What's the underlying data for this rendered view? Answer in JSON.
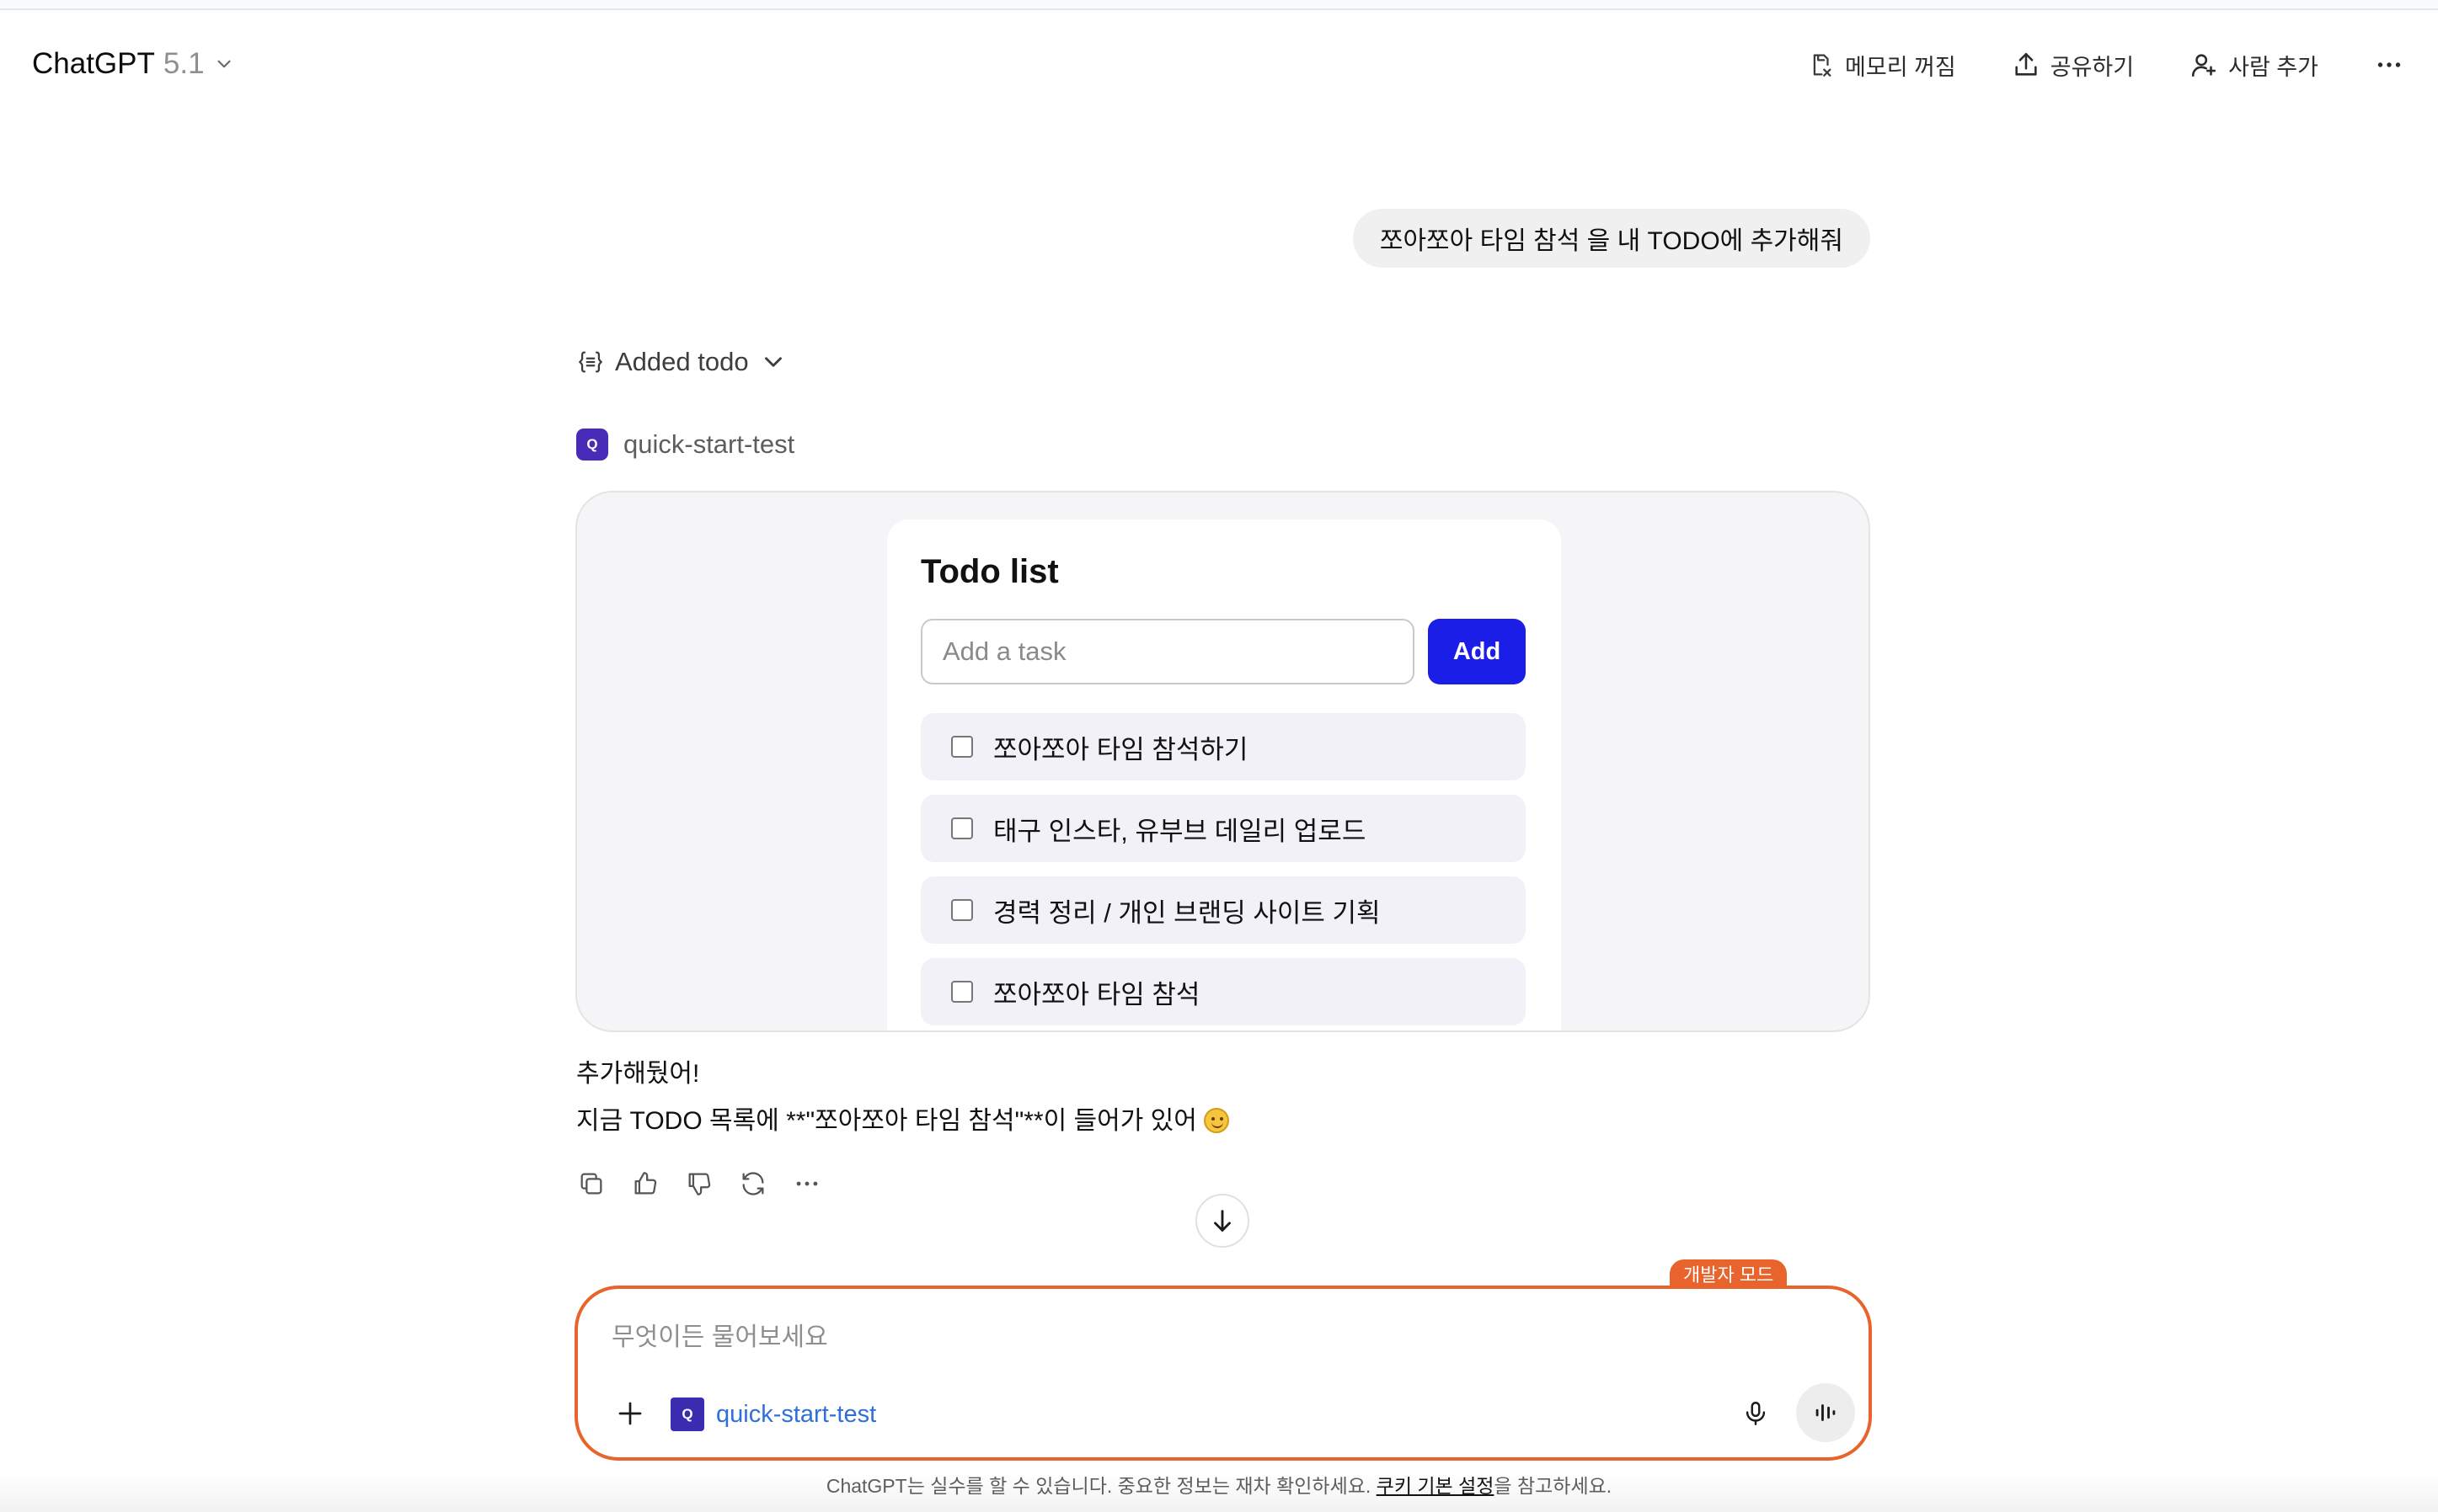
{
  "header": {
    "model_name": "ChatGPT",
    "model_version": "5.1",
    "memory_label": "메모리 꺼짐",
    "share_label": "공유하기",
    "add_people_label": "사람 추가"
  },
  "conversation": {
    "user_message": "쪼아쪼아 타임 참석 을 내 TODO에 추가해줘",
    "tool_call_label": "Added todo",
    "app_name": "quick-start-test",
    "app_badge_letter": "Q",
    "widget": {
      "title": "Todo list",
      "input_placeholder": "Add a task",
      "input_value": "",
      "add_button_label": "Add",
      "items": [
        {
          "text": "쪼아쪼아 타임 참석하기",
          "checked": false
        },
        {
          "text": "태구 인스타, 유부브 데일리 업로드",
          "checked": false
        },
        {
          "text": "경력 정리 / 개인 브랜딩 사이트 기획",
          "checked": false
        },
        {
          "text": "쪼아쪼아 타임 참석",
          "checked": false
        }
      ]
    },
    "assistant_line1": "추가해뒀어!",
    "assistant_line2": "지금 TODO 목록에 **\"쪼아쪼아 타임 참석\"**이 들어가 있어",
    "assistant_emoji": "smiling-face"
  },
  "composer": {
    "dev_mode_badge": "개발자 모드",
    "placeholder": "무엇이든 물어보세요",
    "value": "",
    "app_name": "quick-start-test",
    "app_badge_letter": "Q"
  },
  "footer": {
    "text_before": "ChatGPT는 실수를 할 수 있습니다. 중요한 정보는 재차 확인하세요. ",
    "link": "쿠키 기본 설정",
    "text_after": "을 참고하세요."
  },
  "colors": {
    "accent_orange": "#e8642c",
    "add_button_blue": "#1b1ee6",
    "app_badge_purple": "#4a2bb7",
    "link_blue": "#2f6fd8"
  }
}
